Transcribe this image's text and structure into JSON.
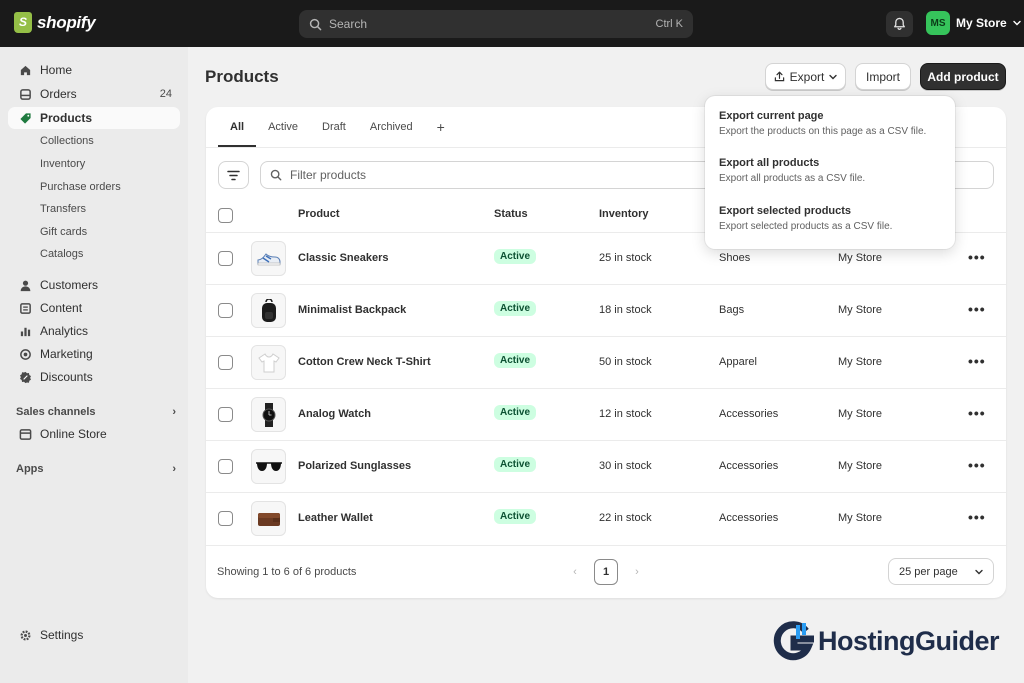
{
  "topbar": {
    "logo_text": "shopify",
    "search_placeholder": "Search",
    "search_shortcut": "Ctrl K",
    "store_initials": "MS",
    "store_name": "My Store"
  },
  "sidebar": {
    "items": [
      {
        "label": "Home",
        "icon": "home-icon"
      },
      {
        "label": "Orders",
        "icon": "orders-icon",
        "count": "24"
      },
      {
        "label": "Products",
        "icon": "tag-icon",
        "active": true
      }
    ],
    "product_subitems": [
      "Collections",
      "Inventory",
      "Purchase orders",
      "Transfers",
      "Gift cards",
      "Catalogs"
    ],
    "items2": [
      {
        "label": "Customers",
        "icon": "person-icon"
      },
      {
        "label": "Content",
        "icon": "content-icon"
      },
      {
        "label": "Analytics",
        "icon": "bar-chart-icon"
      },
      {
        "label": "Marketing",
        "icon": "target-icon"
      },
      {
        "label": "Discounts",
        "icon": "discount-icon"
      }
    ],
    "sales_channels_label": "Sales channels",
    "online_store_label": "Online Store",
    "apps_label": "Apps",
    "settings_label": "Settings"
  },
  "header": {
    "title": "Products",
    "export_label": "Export",
    "import_label": "Import",
    "add_label": "Add product"
  },
  "tabs": [
    "All",
    "Active",
    "Draft",
    "Archived",
    "+"
  ],
  "filter_placeholder": "Filter products",
  "table": {
    "headers": {
      "product": "Product",
      "status": "Status",
      "inventory": "Inventory"
    },
    "rows": [
      {
        "name": "Classic Sneakers",
        "status": "Active",
        "inventory": "25 in stock",
        "type": "Shoes",
        "vendor": "My Store",
        "thumb": "sneaker-icon"
      },
      {
        "name": "Minimalist Backpack",
        "status": "Active",
        "inventory": "18 in stock",
        "type": "Bags",
        "vendor": "My Store",
        "thumb": "backpack-icon"
      },
      {
        "name": "Cotton Crew Neck T-Shirt",
        "status": "Active",
        "inventory": "50 in stock",
        "type": "Apparel",
        "vendor": "My Store",
        "thumb": "tshirt-icon"
      },
      {
        "name": "Analog Watch",
        "status": "Active",
        "inventory": "12 in stock",
        "type": "Accessories",
        "vendor": "My Store",
        "thumb": "watch-icon"
      },
      {
        "name": "Polarized Sunglasses",
        "status": "Active",
        "inventory": "30 in stock",
        "type": "Accessories",
        "vendor": "My Store",
        "thumb": "sunglasses-icon"
      },
      {
        "name": "Leather Wallet",
        "status": "Active",
        "inventory": "22 in stock",
        "type": "Accessories",
        "vendor": "My Store",
        "thumb": "wallet-icon"
      }
    ],
    "more_label": "•••"
  },
  "footer": {
    "showing": "Showing 1 to 6 of 6 products",
    "page": "1",
    "per_page": "25 per page"
  },
  "export_menu": [
    {
      "title": "Export current page",
      "desc": "Export the products on this page as a CSV file."
    },
    {
      "title": "Export all products",
      "desc": "Export all products as a CSV file."
    },
    {
      "title": "Export selected products",
      "desc": "Export selected products as a CSV file."
    }
  ],
  "watermark": {
    "text": "HostingGuider"
  },
  "colors": {
    "brand_green": "#95bf47",
    "badge_bg": "#cdfee1",
    "badge_text": "#0c5132",
    "topbar": "#1a1a1a",
    "primary_button": "#303030"
  }
}
